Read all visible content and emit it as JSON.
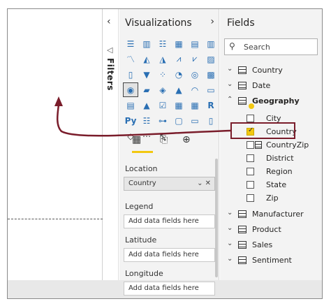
{
  "filters": {
    "label": "Filters"
  },
  "visualizations": {
    "title": "Visualizations",
    "location_label": "Location",
    "location_value": "Country",
    "location_actions": "⌄ ✕",
    "legend_label": "Legend",
    "legend_placeholder": "Add data fields here",
    "latitude_label": "Latitude",
    "latitude_placeholder": "Add data fields here",
    "longitude_label": "Longitude",
    "longitude_placeholder": "Add data fields here"
  },
  "fields": {
    "title": "Fields",
    "search_placeholder": "Search",
    "tables": [
      {
        "name": "Country"
      },
      {
        "name": "Date"
      },
      {
        "name": "Geography"
      },
      {
        "name": "Manufacturer"
      },
      {
        "name": "Product"
      },
      {
        "name": "Sales"
      },
      {
        "name": "Sentiment"
      }
    ],
    "geography_fields": [
      {
        "name": "City",
        "checked": false
      },
      {
        "name": "Country",
        "checked": true
      },
      {
        "name": "CountryZip",
        "checked": false
      },
      {
        "name": "District",
        "checked": false
      },
      {
        "name": "Region",
        "checked": false
      },
      {
        "name": "State",
        "checked": false
      },
      {
        "name": "Zip",
        "checked": false
      }
    ]
  },
  "colors": {
    "accent": "#f2c811",
    "arrow": "#7a1d2b",
    "icon_blue": "#2a6fb3"
  }
}
